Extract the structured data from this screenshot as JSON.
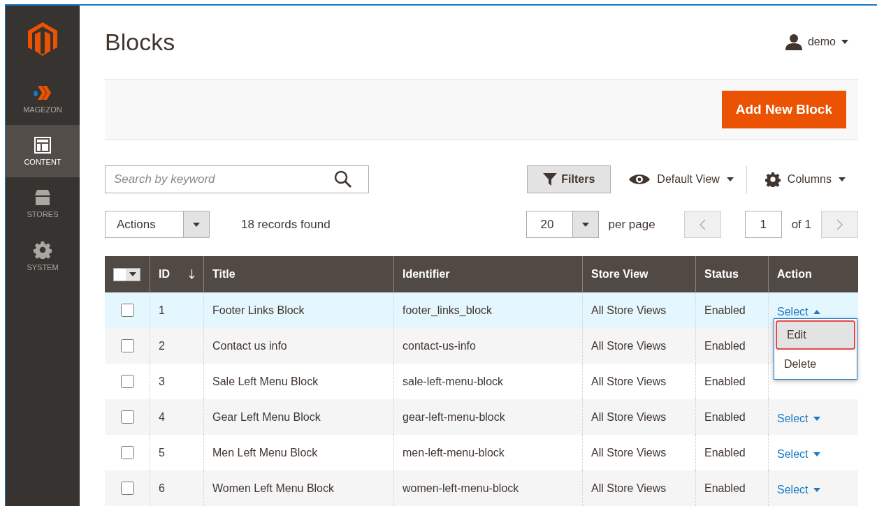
{
  "sidebar": {
    "items": [
      {
        "kind": "magezon",
        "label": "MAGEZON",
        "selected": false
      },
      {
        "kind": "content",
        "label": "CONTENT",
        "selected": true
      },
      {
        "kind": "stores",
        "label": "STORES",
        "selected": false
      },
      {
        "kind": "system",
        "label": "SYSTEM",
        "selected": false
      }
    ]
  },
  "page_title": "Blocks",
  "user": "demo",
  "add_button": "Add New Block",
  "search": {
    "placeholder": "Search by keyword"
  },
  "filters": "Filters",
  "view": "Default View",
  "columns_control": "Columns",
  "actions": "Actions",
  "records": "18 records found",
  "per_page": {
    "value": "20",
    "label": "per page"
  },
  "pager": {
    "page": "1",
    "of": "of 1"
  },
  "table": {
    "header_checkbox": {
      "checked": false
    },
    "columns": [
      "ID",
      "Title",
      "Identifier",
      "Store View",
      "Status",
      "Action"
    ],
    "rows": [
      {
        "id": "1",
        "title": "Footer Links Block",
        "identifier": "footer_links_block",
        "store": "All Store Views",
        "status": "Enabled",
        "action": "Select",
        "checked": false,
        "expanded": true
      },
      {
        "id": "2",
        "title": "Contact us info",
        "identifier": "contact-us-info",
        "store": "All Store Views",
        "status": "Enabled",
        "checked": false
      },
      {
        "id": "3",
        "title": "Sale Left Menu Block",
        "identifier": "sale-left-menu-block",
        "store": "All Store Views",
        "status": "Enabled",
        "checked": false
      },
      {
        "id": "4",
        "title": "Gear Left Menu Block",
        "identifier": "gear-left-menu-block",
        "store": "All Store Views",
        "status": "Enabled",
        "action": "Select",
        "checked": false,
        "expanded": false
      },
      {
        "id": "5",
        "title": "Men Left Menu Block",
        "identifier": "men-left-menu-block",
        "store": "All Store Views",
        "status": "Enabled",
        "action": "Select",
        "checked": false,
        "expanded": false
      },
      {
        "id": "6",
        "title": "Women Left Menu Block",
        "identifier": "women-left-menu-block",
        "store": "All Store Views",
        "status": "Enabled",
        "action": "Select",
        "checked": false,
        "expanded": false
      }
    ]
  },
  "action_menu": [
    {
      "label": "Edit",
      "selected": true
    },
    {
      "label": "Delete",
      "selected": false
    }
  ]
}
